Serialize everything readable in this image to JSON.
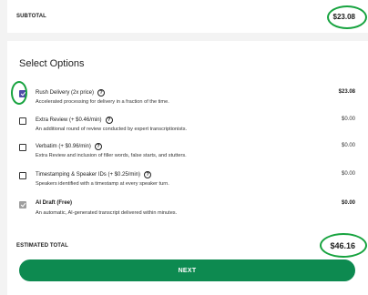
{
  "subtotal": {
    "label": "SUBTOTAL",
    "value": "$23.08"
  },
  "section_title": "Select Options",
  "options": [
    {
      "title": "Rush Delivery (2x price)",
      "desc": "Accelerated processing for delivery in a fraction of the time.",
      "price": "$23.08",
      "state": "checked"
    },
    {
      "title": "Extra Review (+ $0.46/min)",
      "desc": "An additional round of review conducted by expert transcriptionists.",
      "price": "$0.00",
      "state": "unchecked"
    },
    {
      "title": "Verbatim (+ $0.96/min)",
      "desc": "Extra Review and inclusion of filler words, false starts, and stutters.",
      "price": "$0.00",
      "state": "unchecked"
    },
    {
      "title": "Timestamping & Speaker IDs (+ $0.25/min)",
      "desc": "Speakers identified with a timestamp at every speaker turn.",
      "price": "$0.00",
      "state": "unchecked"
    },
    {
      "title": "AI Draft (Free)",
      "desc": "An automatic, AI-generated transcript delivered within minutes.",
      "price": "$0.00",
      "state": "checked-disabled"
    }
  ],
  "estimated_total": {
    "label": "ESTIMATED TOTAL",
    "value": "$46.16"
  },
  "next_button": "NEXT",
  "colors": {
    "accent_green": "#0d8a50",
    "highlight_ring": "#17a33f",
    "checkbox_checked": "#4f4ca8"
  }
}
